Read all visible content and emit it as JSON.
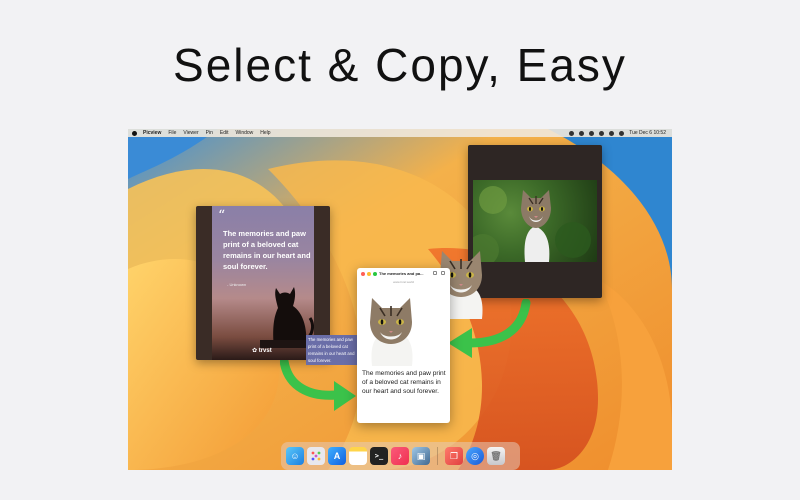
{
  "headline": "Select & Copy, Easy",
  "menubar": {
    "app_name": "Picview",
    "items": [
      "File",
      "Viewer",
      "Pin",
      "Edit",
      "Window",
      "Help"
    ],
    "clock": "Tue Dec 6  10:52"
  },
  "quote_image": {
    "quote_mark": "“",
    "text": "The memories and paw print of a beloved cat remains in our heart and soul forever.",
    "author": "- Unknown",
    "brand": "✿ trvst"
  },
  "selected_text": "The memories and paw print of a beloved cat remains in our heart and soul forever.",
  "preview_window": {
    "title": "The memories and pa...",
    "subtitle": "www.trvst.world",
    "text": "The memories and paw print of a beloved cat remains in our heart and soul forever."
  },
  "colors": {
    "arrow": "#3bc24a",
    "selection": "#6a6ea8"
  },
  "dock": {
    "icons": [
      "finder-icon",
      "launchpad-icon",
      "app-store-icon",
      "notes-icon",
      "terminal-icon",
      "music-icon",
      "picview-icon",
      "pinned-app-icon",
      "safari-icon",
      "trash-icon"
    ]
  }
}
